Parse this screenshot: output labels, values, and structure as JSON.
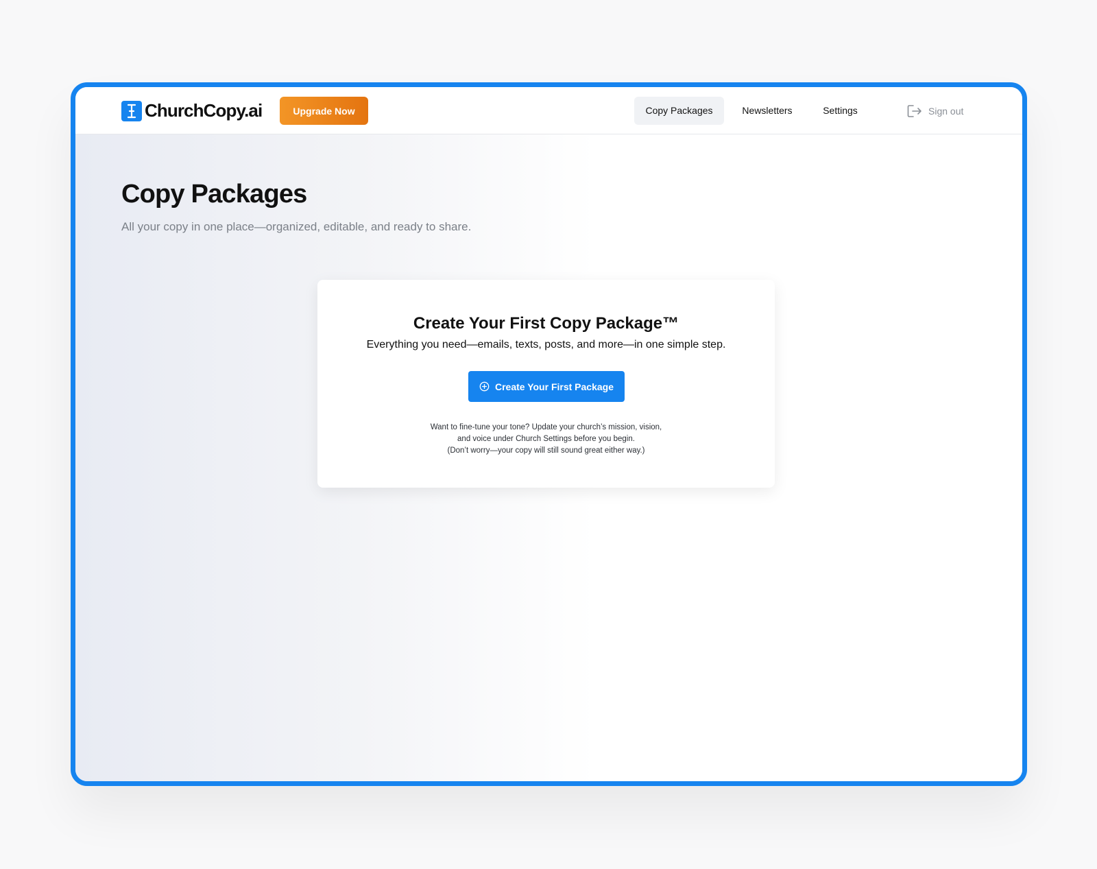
{
  "brand": {
    "name": "ChurchCopy.ai",
    "logo_icon": "cursor-text-icon",
    "accent_color": "#1684ef"
  },
  "header": {
    "upgrade_label": "Upgrade Now",
    "upgrade_colors": [
      "#f39526",
      "#e47410"
    ],
    "nav": [
      {
        "label": "Copy Packages",
        "active": true
      },
      {
        "label": "Newsletters",
        "active": false
      },
      {
        "label": "Settings",
        "active": false
      }
    ],
    "signout_label": "Sign out",
    "signout_icon": "sign-out-icon"
  },
  "main": {
    "title": "Copy Packages",
    "subtitle": "All your copy in one place—organized, editable, and ready to share."
  },
  "empty_state": {
    "title": "Create Your First Copy Package™",
    "subtitle": "Everything you need—emails, texts, posts, and more—in one simple step.",
    "button_label": "Create Your First Package",
    "button_icon": "plus-circle-icon",
    "note_lines": [
      "Want to fine-tune your tone? Update your church’s mission, vision,",
      "and voice under Church Settings before you begin.",
      "(Don’t worry—your copy will still sound great either way.)"
    ]
  }
}
